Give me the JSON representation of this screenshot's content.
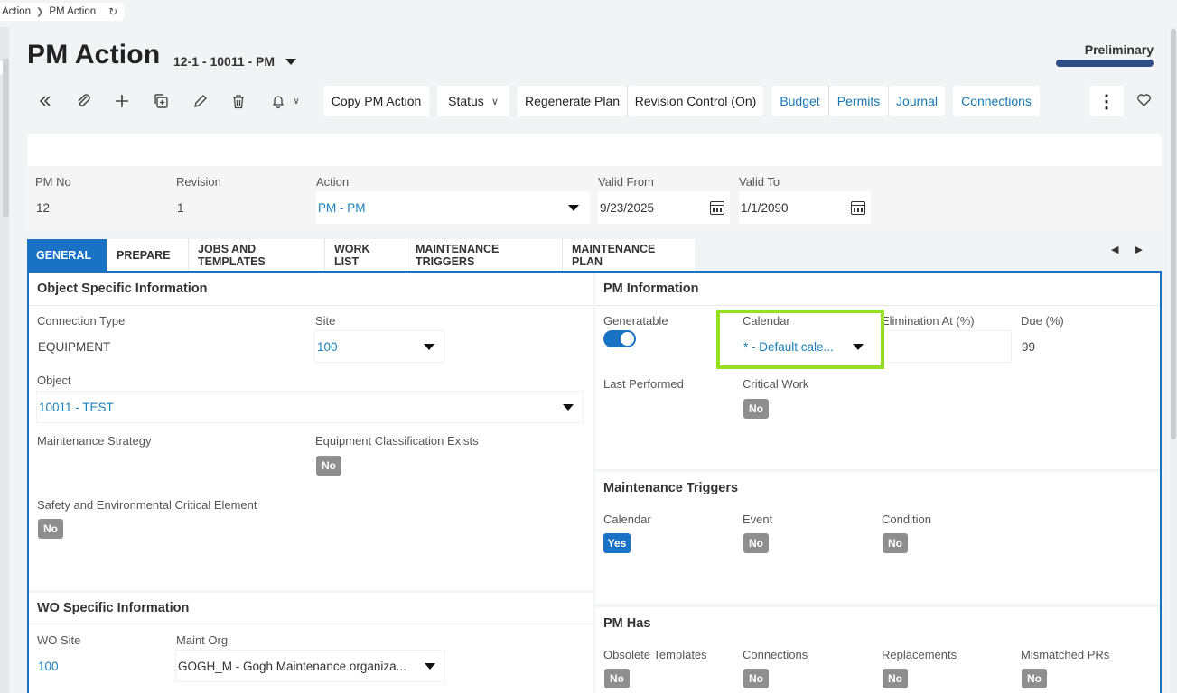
{
  "breadcrumb": {
    "parent": "Action",
    "current": "PM Action"
  },
  "header": {
    "title": "PM Action",
    "record_id": "12-1 - 10011 - PM",
    "state": "Preliminary"
  },
  "toolbar": {
    "copy_label": "Copy PM Action",
    "status_label": "Status",
    "regenerate_label": "Regenerate Plan",
    "revision_label": "Revision Control (On)",
    "budget_label": "Budget",
    "permits_label": "Permits",
    "journal_label": "Journal",
    "connections_label": "Connections",
    "icons": [
      "collapse-icon",
      "attachment-icon",
      "plus-icon",
      "duplicate-icon",
      "edit-icon",
      "delete-icon",
      "bell-icon",
      "more-icon",
      "favorite-icon"
    ]
  },
  "summary": {
    "pm_no_label": "PM No",
    "pm_no": "12",
    "revision_label": "Revision",
    "revision": "1",
    "action_label": "Action",
    "action": "PM - PM",
    "valid_from_label": "Valid From",
    "valid_from": "9/23/2025",
    "valid_to_label": "Valid To",
    "valid_to": "1/1/2090"
  },
  "tabs": [
    "GENERAL",
    "PREPARE",
    "JOBS AND TEMPLATES",
    "WORK LIST",
    "MAINTENANCE TRIGGERS",
    "MAINTENANCE PLAN"
  ],
  "object_info": {
    "title": "Object Specific Information",
    "connection_type_label": "Connection Type",
    "connection_type": "EQUIPMENT",
    "site_label": "Site",
    "site": "100",
    "object_label": "Object",
    "object": "10011 - TEST",
    "strategy_label": "Maintenance Strategy",
    "eq_class_label": "Equipment Classification Exists",
    "eq_class": "No",
    "safety_label": "Safety and Environmental Critical Element",
    "safety": "No"
  },
  "wo_info": {
    "title": "WO Specific Information",
    "wo_site_label": "WO Site",
    "wo_site": "100",
    "maint_org_label": "Maint Org",
    "maint_org": "GOGH_M - Gogh Maintenance organiza..."
  },
  "pm_info": {
    "title": "PM Information",
    "generatable_label": "Generatable",
    "calendar_label": "Calendar",
    "calendar": "* - Default cale...",
    "elimination_label": "Elimination At (%)",
    "due_label": "Due (%)",
    "due": "99",
    "last_performed_label": "Last Performed",
    "critical_label": "Critical Work",
    "critical": "No"
  },
  "triggers": {
    "title": "Maintenance Triggers",
    "calendar_label": "Calendar",
    "calendar": "Yes",
    "event_label": "Event",
    "event": "No",
    "condition_label": "Condition",
    "condition": "No"
  },
  "pm_has": {
    "title": "PM Has",
    "obsolete_label": "Obsolete Templates",
    "obsolete": "No",
    "connections_label": "Connections",
    "connections": "No",
    "replacements_label": "Replacements",
    "replacements": "No",
    "mismatched_label": "Mismatched PRs",
    "mismatched": "No"
  },
  "colors": {
    "accent": "#1a72c4",
    "highlight": "#96e022",
    "state_bar": "#2e4f86"
  }
}
